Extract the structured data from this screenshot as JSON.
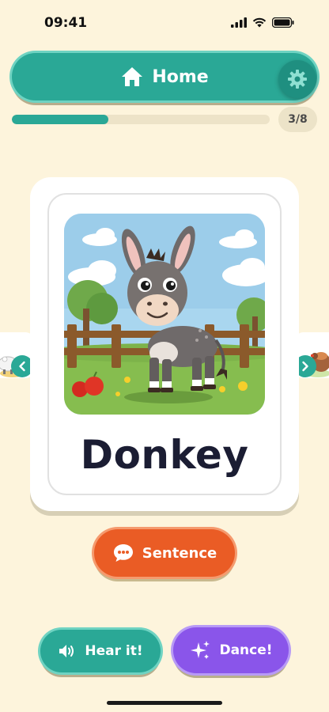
{
  "status_bar": {
    "time": "09:41"
  },
  "header": {
    "home_label": "Home"
  },
  "progress": {
    "current": 3,
    "total": 8,
    "label": "3/8",
    "fraction": 0.375
  },
  "card": {
    "word": "Donkey",
    "image_subject": "donkey"
  },
  "actions": {
    "sentence_label": "Sentence",
    "hear_label": "Hear it!",
    "dance_label": "Dance!"
  },
  "colors": {
    "background": "#fdf4dc",
    "teal": "#2aa896",
    "orange": "#ea5c25",
    "purple": "#8a55ea",
    "word_text": "#1b1d33"
  },
  "icons": {
    "home": "home-icon",
    "settings": "gear-icon",
    "prev": "chevron-left-icon",
    "next": "chevron-right-icon",
    "sentence": "speech-bubble-icon",
    "hear": "speaker-icon",
    "dance": "sparkles-icon"
  }
}
